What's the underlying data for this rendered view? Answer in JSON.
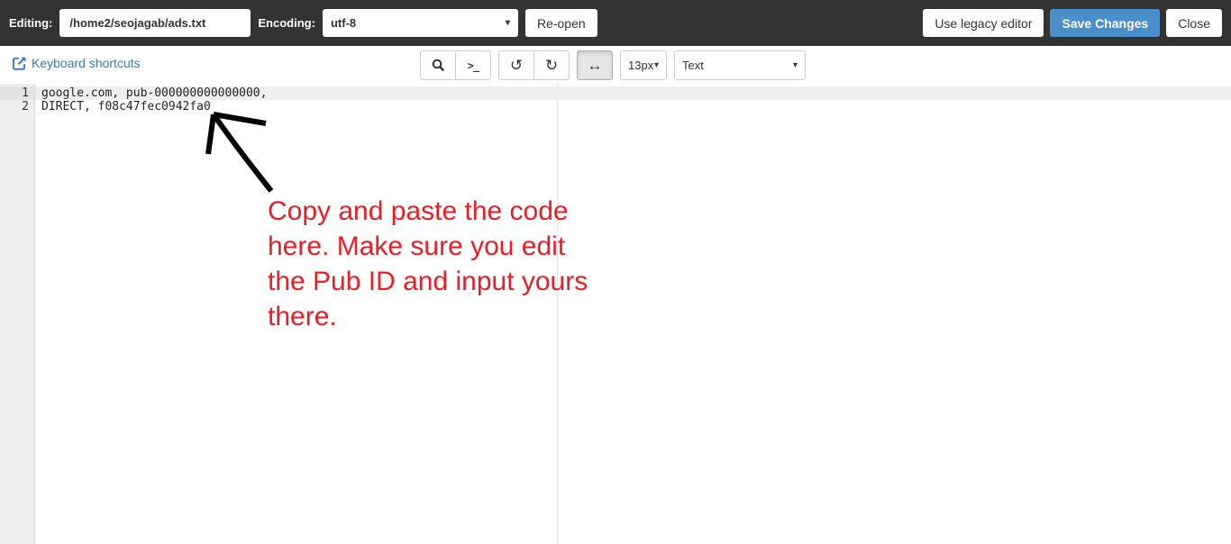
{
  "header": {
    "editing_label": "Editing:",
    "file_path": "/home2/seojagab/ads.txt",
    "encoding_label": "Encoding:",
    "encoding_value": "utf-8",
    "reopen_button": "Re-open",
    "legacy_button": "Use legacy editor",
    "save_button": "Save Changes",
    "close_button": "Close"
  },
  "toolbar": {
    "keyboard_shortcuts": "Keyboard shortcuts",
    "font_size": "13px",
    "syntax_mode": "Text"
  },
  "icons": {
    "keyboard_shortcuts": "external-link-square-icon",
    "search": "magnifier-icon",
    "terminal": ">_",
    "undo": "↺",
    "redo": "↻",
    "word_wrap": "↔",
    "caret": "▾"
  },
  "editor": {
    "active_line": "1",
    "lines": [
      {
        "number": "1",
        "text": "google.com, pub-000000000000000,"
      },
      {
        "number": "2",
        "text": "DIRECT, f08c47fec0942fa0"
      }
    ]
  },
  "annotation": {
    "text_lines": [
      "Copy and paste the code",
      "here. Make sure you edit",
      "the Pub ID and input yours",
      "there."
    ],
    "color": "#ed1c24"
  },
  "colors": {
    "header_bg": "#333333",
    "save_button_blue": "#4a8fcb",
    "link_blue": "#3a7abf",
    "annotation_red": "#ed1c24"
  }
}
